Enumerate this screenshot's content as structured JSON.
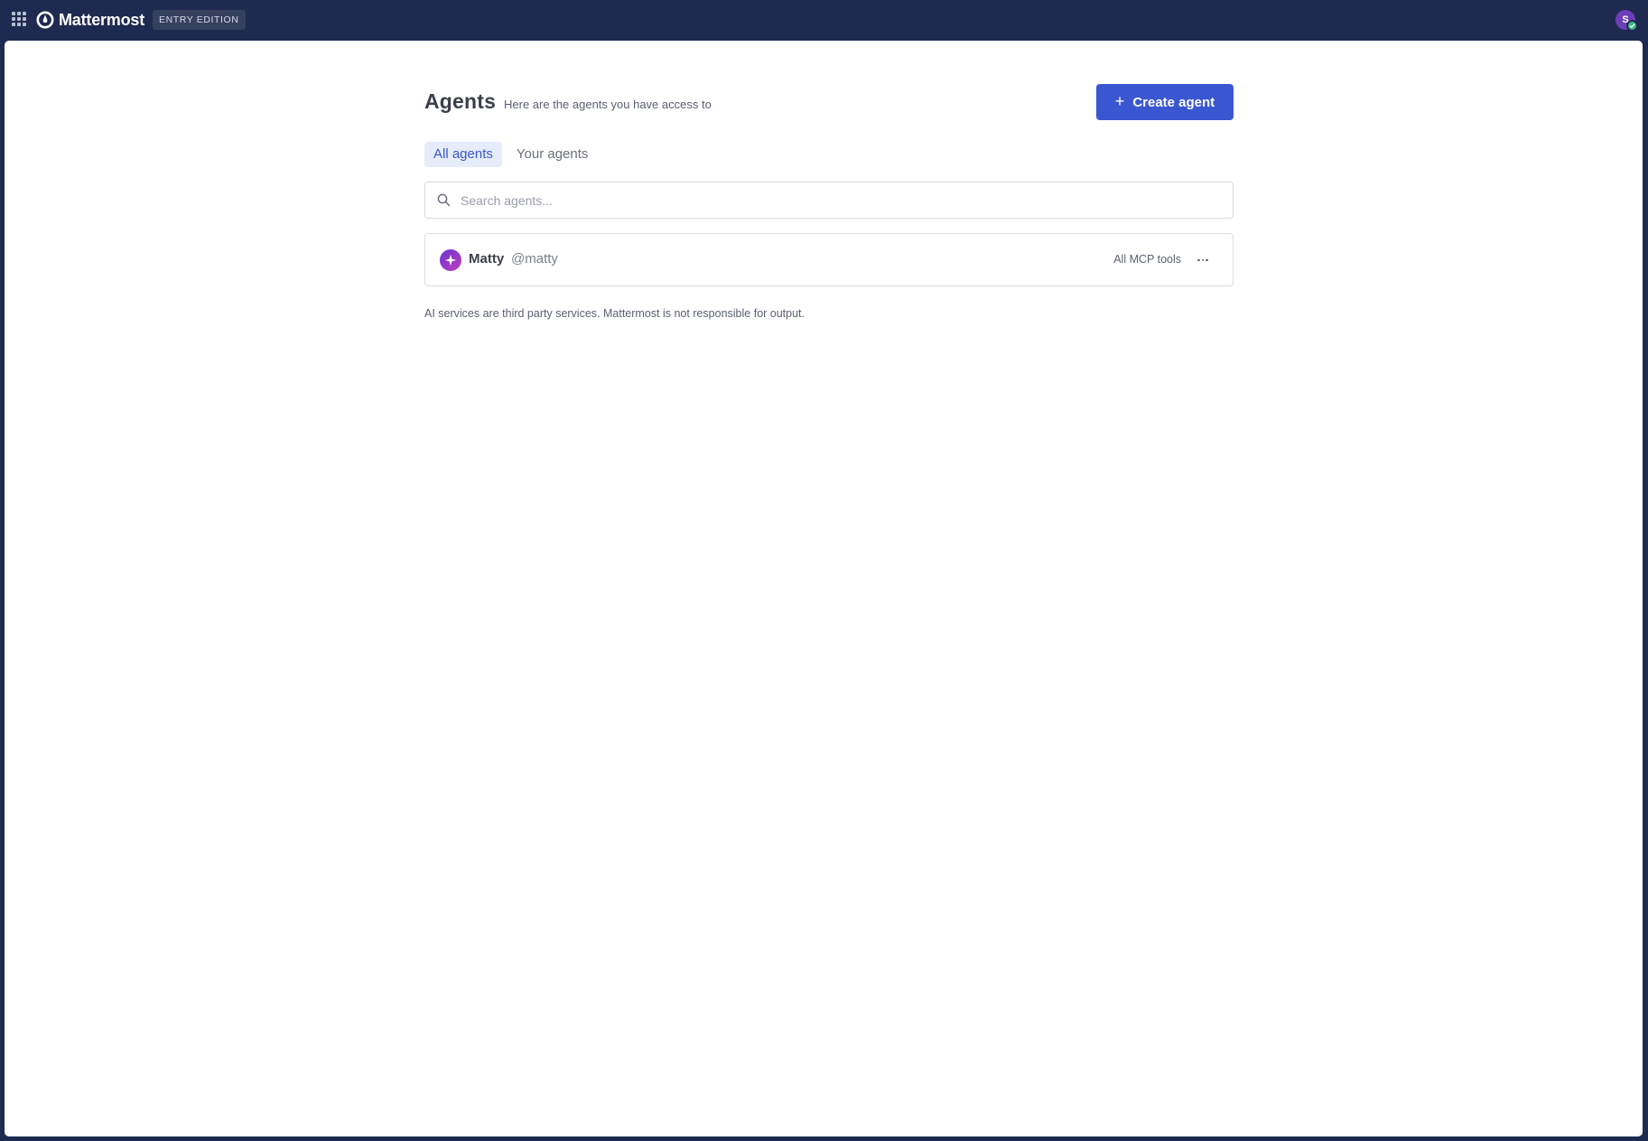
{
  "topbar": {
    "app_name": "Mattermost",
    "edition_badge": "ENTRY EDITION",
    "user_initial": "S",
    "status": "online"
  },
  "page": {
    "title": "Agents",
    "subtitle": "Here are the agents you have access to",
    "create_button_label": "Create agent"
  },
  "tabs": [
    {
      "label": "All agents",
      "active": true
    },
    {
      "label": "Your agents",
      "active": false
    }
  ],
  "search": {
    "placeholder": "Search agents...",
    "value": ""
  },
  "agents": [
    {
      "name": "Matty",
      "handle": "@matty",
      "tools": "All MCP tools"
    }
  ],
  "disclaimer": "AI services are third party services. Mattermost is not responsible for output.",
  "colors": {
    "header_bg": "#1e2a4f",
    "accent": "#3b56d1",
    "tab_active_bg": "#e6ecfa",
    "status_online": "#3db887"
  }
}
